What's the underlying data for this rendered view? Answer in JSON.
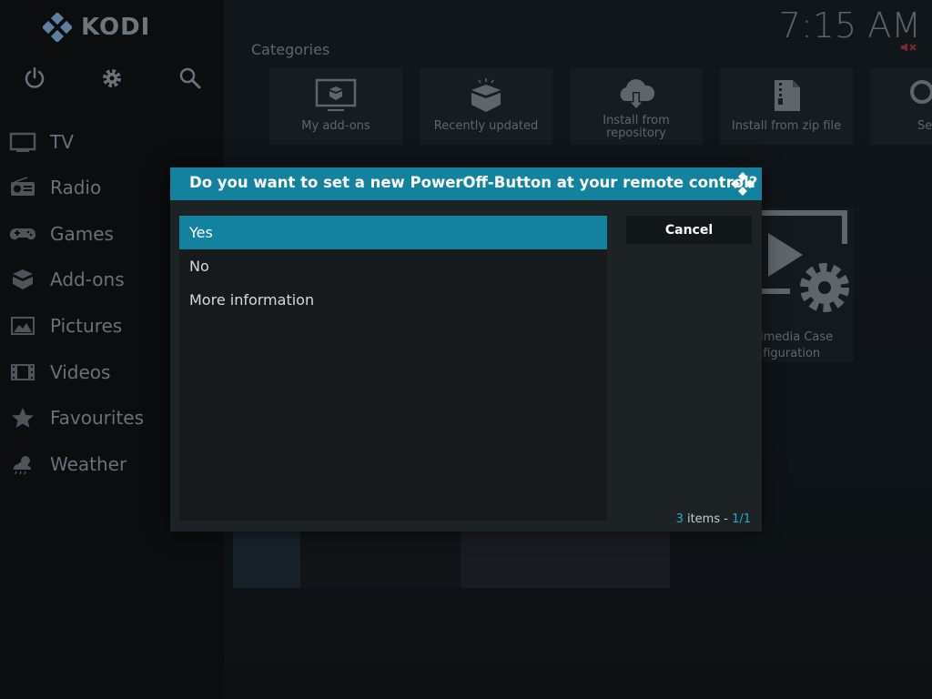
{
  "app": {
    "name": "KODI"
  },
  "clock": "7:15 AM",
  "colors": {
    "accent": "#12829f",
    "accent_text": "#2aa7cc"
  },
  "top_icons": [
    {
      "name": "power-icon"
    },
    {
      "name": "settings-icon"
    },
    {
      "name": "search-icon"
    }
  ],
  "menu": [
    {
      "label": "TV",
      "icon": "tv-icon"
    },
    {
      "label": "Radio",
      "icon": "radio-icon"
    },
    {
      "label": "Games",
      "icon": "gamepad-icon"
    },
    {
      "label": "Add-ons",
      "icon": "addons-box-icon"
    },
    {
      "label": "Pictures",
      "icon": "pictures-icon"
    },
    {
      "label": "Videos",
      "icon": "film-icon"
    },
    {
      "label": "Favourites",
      "icon": "star-icon"
    },
    {
      "label": "Weather",
      "icon": "weather-icon"
    }
  ],
  "categories": {
    "title": "Categories",
    "tiles": [
      {
        "label": "My add-ons",
        "icon": "monitor-box-icon"
      },
      {
        "label": "Recently updated",
        "icon": "open-box-icon"
      },
      {
        "label_line1": "Install from",
        "label_line2": "repository",
        "icon": "cloud-download-icon"
      },
      {
        "label": "Install from zip file",
        "icon": "zip-file-icon"
      },
      {
        "label": "Se",
        "icon": "search-icon"
      }
    ]
  },
  "large_tile": {
    "line1": "timedia Case",
    "line2": "nfiguration",
    "icon": "video-settings-icon"
  },
  "dialog": {
    "title": "Do you want to set a new PowerOff-Button at your remote control?",
    "options": [
      "Yes",
      "No",
      "More information"
    ],
    "selected_index": 0,
    "cancel_label": "Cancel",
    "count_num": "3",
    "count_text": " items - ",
    "count_page": "1/1"
  }
}
